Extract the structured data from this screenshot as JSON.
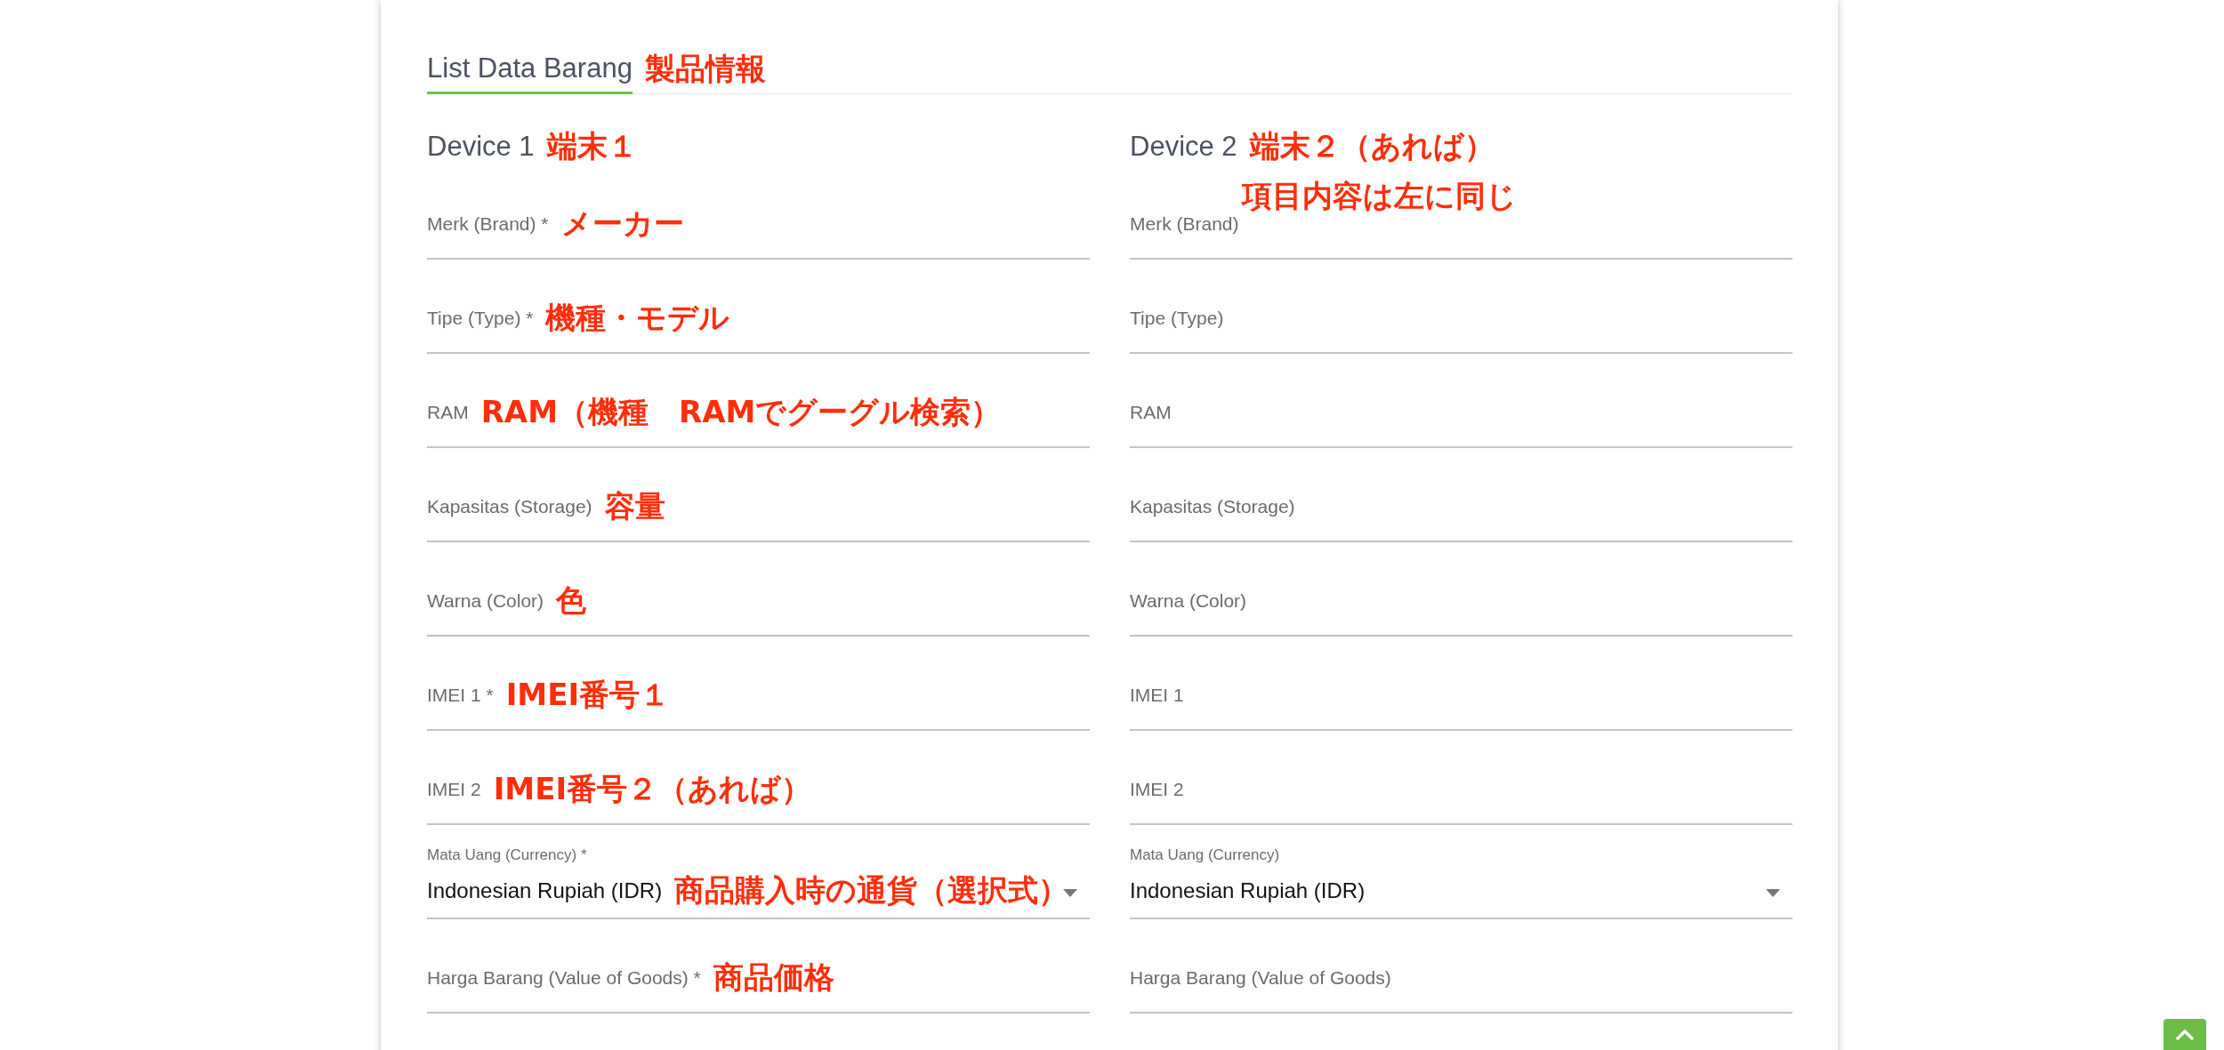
{
  "tab": {
    "label": "List Data Barang",
    "selected": true,
    "note": "製品情報"
  },
  "devices": [
    {
      "title": "Device 1",
      "notes": [
        "端末１"
      ],
      "fields": [
        {
          "kind": "text",
          "label": "Merk (Brand) *",
          "note": "メーカー"
        },
        {
          "kind": "text",
          "label": "Tipe (Type) *",
          "note": "機種・モデル"
        },
        {
          "kind": "text",
          "label": "RAM",
          "note": "RAM（機種　RAMでグーグル検索）"
        },
        {
          "kind": "text",
          "label": "Kapasitas (Storage)",
          "note": "容量"
        },
        {
          "kind": "text",
          "label": "Warna (Color)",
          "note": "色"
        },
        {
          "kind": "text",
          "label": "IMEI 1 *",
          "note": "IMEI番号１"
        },
        {
          "kind": "text",
          "label": "IMEI 2",
          "note": "IMEI番号２（あれば）"
        },
        {
          "kind": "select",
          "label": "Mata Uang (Currency) *",
          "value": "Indonesian Rupiah (IDR)",
          "note": "商品購入時の通貨（選択式）"
        },
        {
          "kind": "text",
          "label": "Harga Barang (Value of Goods) *",
          "note": "商品価格"
        }
      ]
    },
    {
      "title": "Device 2",
      "notes": [
        "端末２（あれば）",
        "項目内容は左に同じ"
      ],
      "fields": [
        {
          "kind": "text",
          "label": "Merk (Brand)"
        },
        {
          "kind": "text",
          "label": "Tipe (Type)"
        },
        {
          "kind": "text",
          "label": "RAM"
        },
        {
          "kind": "text",
          "label": "Kapasitas (Storage)"
        },
        {
          "kind": "text",
          "label": "Warna (Color)"
        },
        {
          "kind": "text",
          "label": "IMEI 1"
        },
        {
          "kind": "text",
          "label": "IMEI 2"
        },
        {
          "kind": "select",
          "label": "Mata Uang (Currency)",
          "value": "Indonesian Rupiah (IDR)"
        },
        {
          "kind": "text",
          "label": "Harga Barang (Value of Goods)"
        }
      ]
    }
  ]
}
